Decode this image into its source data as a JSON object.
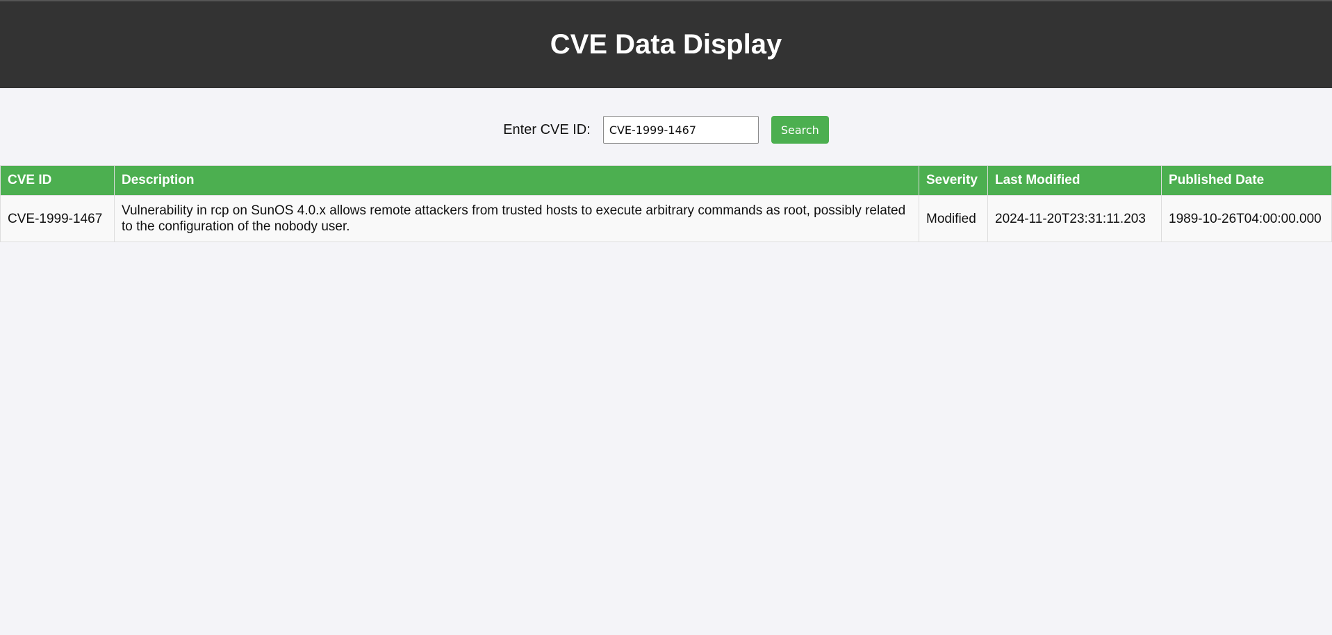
{
  "header": {
    "title": "CVE Data Display"
  },
  "search": {
    "label": "Enter CVE ID:",
    "value": "CVE-1999-1467",
    "button_label": "Search"
  },
  "table": {
    "columns": [
      "CVE ID",
      "Description",
      "Severity",
      "Last Modified",
      "Published Date"
    ],
    "rows": [
      {
        "cve_id": "CVE-1999-1467",
        "description": "Vulnerability in rcp on SunOS 4.0.x allows remote attackers from trusted hosts to execute arbitrary commands as root, possibly related to the configuration of the nobody user.",
        "severity": "Modified",
        "last_modified": "2024-11-20T23:31:11.203",
        "published_date": "1989-10-26T04:00:00.000"
      }
    ]
  },
  "colors": {
    "header_bg": "#333333",
    "accent": "#4caf50",
    "page_bg": "#f4f4f8"
  }
}
